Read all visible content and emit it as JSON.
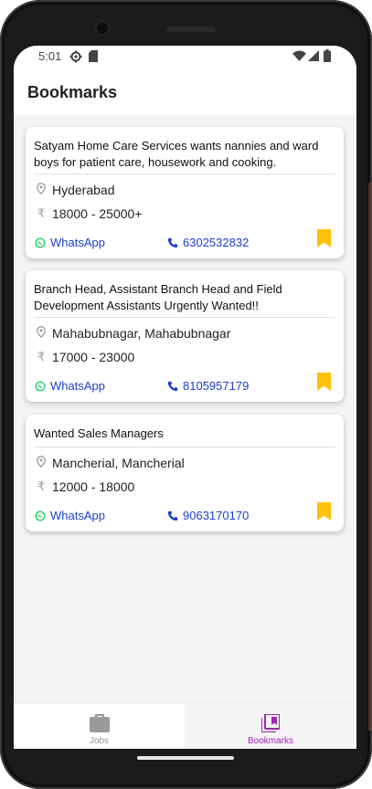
{
  "status": {
    "time": "5:01"
  },
  "appbar": {
    "title": "Bookmarks"
  },
  "cards": [
    {
      "title": "Satyam Home Care Services wants nannies and ward boys for patient care, housework and cooking.",
      "location": "Hyderabad",
      "salary": "18000 - 25000+",
      "whatsapp_label": "WhatsApp",
      "phone": "6302532832"
    },
    {
      "title": "Branch Head, Assistant Branch Head and Field Development Assistants Urgently Wanted!!",
      "location": "Mahabubnagar, Mahabubnagar",
      "salary": "17000 - 23000",
      "whatsapp_label": "WhatsApp",
      "phone": "8105957179"
    },
    {
      "title": "Wanted Sales Managers",
      "location": "Mancherial, Mancherial",
      "salary": "12000 - 18000",
      "whatsapp_label": "WhatsApp",
      "phone": "9063170170"
    }
  ],
  "bottom_nav": {
    "items": [
      {
        "label": "Jobs",
        "icon": "briefcase-icon"
      },
      {
        "label": "Bookmarks",
        "icon": "bookmarks-icon"
      }
    ]
  },
  "colors": {
    "link": "#1b3fd1",
    "whatsapp": "#25d366",
    "bookmark": "#ffc107",
    "active_nav": "#9c27b0"
  }
}
